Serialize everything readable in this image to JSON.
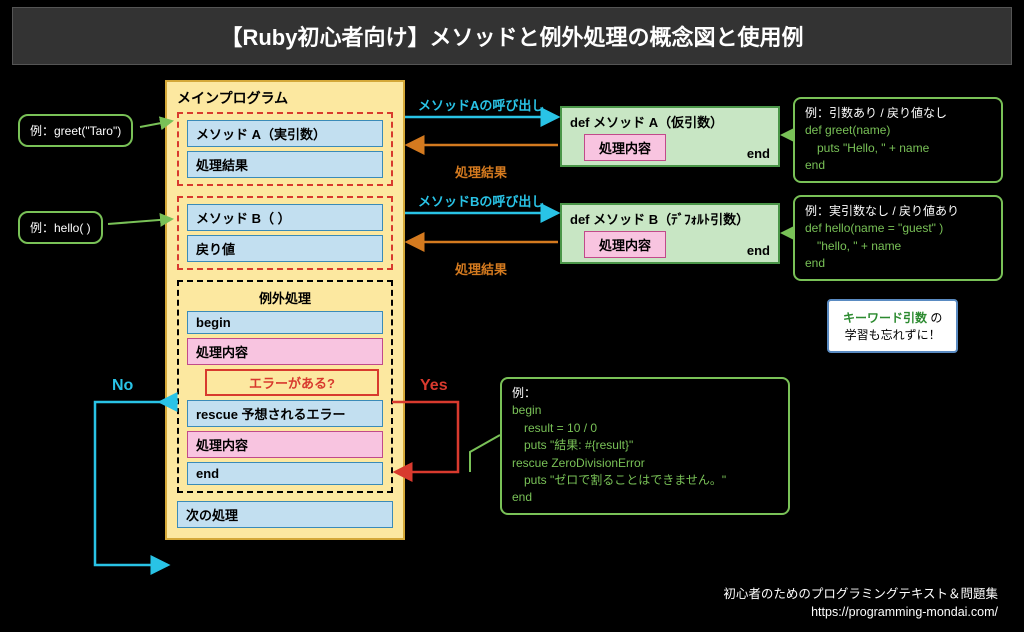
{
  "header": {
    "title": "【Ruby初心者向け】メソッドと例外処理の概念図と使用例"
  },
  "main": {
    "title": "メインプログラム",
    "groupA": {
      "call": "メソッド A（実引数）",
      "result": "処理結果"
    },
    "groupB": {
      "call": "メソッド B（ ）",
      "result": "戻り値"
    },
    "exception": {
      "title": "例外処理",
      "begin": "begin",
      "body": "処理内容",
      "errorQuestion": "エラーがある?",
      "rescue": "rescue 予想されるエラー",
      "rescueBody": "処理内容",
      "end": "end"
    },
    "next": "次の処理"
  },
  "labels": {
    "callA": "メソッドAの呼び出し",
    "resA": "処理結果",
    "callB": "メソッドBの呼び出し",
    "resB": "処理結果",
    "no": "No",
    "yes": "Yes"
  },
  "methodA": {
    "sig": "def メソッド A（仮引数）",
    "body": "処理内容",
    "end": "end"
  },
  "methodB": {
    "sig": "def メソッド B（ﾃﾞﾌｫﾙﾄ引数）",
    "body": "処理内容",
    "end": "end"
  },
  "leftBubbles": {
    "a": "例：greet(\"Taro\")",
    "b": "例：hello( )"
  },
  "calloutA": {
    "head": "例：引数あり / 戻り値なし",
    "l1": "def greet(name)",
    "l2": "　puts \"Hello, \" + name",
    "l3": "end"
  },
  "calloutB": {
    "head": "例：実引数なし / 戻り値あり",
    "l1": "def hello(name = \"guest\" )",
    "l2": "　\"hello, \" + name",
    "l3": "end"
  },
  "calloutRescue": {
    "head": "例：",
    "l1": "begin",
    "l2": "　result = 10 / 0",
    "l3": "　puts \"結果: #{result}\"",
    "l4": "rescue ZeroDivisionError",
    "l5": "　puts \"ゼロで割ることはできません。\"",
    "l6": "end"
  },
  "scroll": {
    "kw": "キーワード引数",
    "rest": " の",
    "l2": "学習も忘れずに！"
  },
  "footer": {
    "l1": "初心者のためのプログラミングテキスト＆問題集",
    "l2": "https://programming-mondai.com/"
  }
}
